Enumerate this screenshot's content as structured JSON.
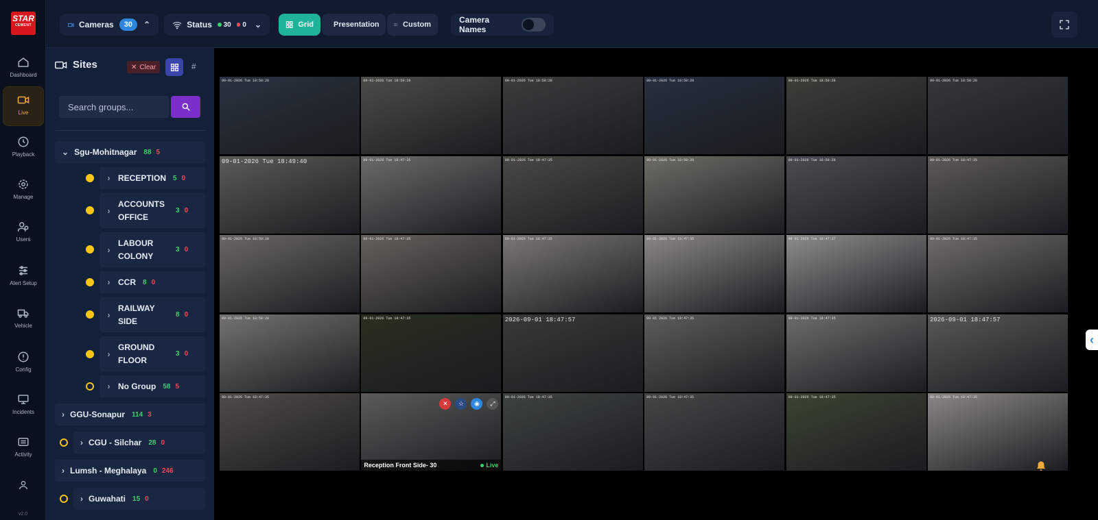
{
  "brand": {
    "logo_text": "STAR",
    "logo_sub": "CEMENT"
  },
  "nav": [
    {
      "label": "Dashboard",
      "icon": "home-icon"
    },
    {
      "label": "Live",
      "icon": "video-icon",
      "active": true
    },
    {
      "label": "Playback",
      "icon": "clock-icon"
    },
    {
      "label": "Manage",
      "icon": "gear-icon"
    },
    {
      "label": "Users",
      "icon": "users-icon"
    },
    {
      "label": "Alert Setup",
      "icon": "sliders-icon"
    },
    {
      "label": "Vehicle",
      "icon": "truck-icon"
    },
    {
      "label": "Config",
      "icon": "alert-circle-icon"
    },
    {
      "label": "Incidents",
      "icon": "monitor-icon"
    },
    {
      "label": "Activity",
      "icon": "list-icon"
    },
    {
      "label": "",
      "icon": "user-icon"
    }
  ],
  "version": "v2.0",
  "toolbar": {
    "cameras_label": "Cameras",
    "cameras_count": "30",
    "status_label": "Status",
    "status_online": "30",
    "status_offline": "0",
    "views": [
      "Grid",
      "Presentation",
      "Custom"
    ],
    "active_view": "Grid",
    "camera_names_label": "Camera Names",
    "camera_names_on": false
  },
  "sidebar": {
    "title": "Sites",
    "clear_label": "Clear",
    "hash_label": "#",
    "search_placeholder": "Search groups...",
    "groups": [
      {
        "name": "Sgu-Mohitnagar",
        "online": "88",
        "offline": "5",
        "expanded": true,
        "children": [
          {
            "name": "RECEPTION",
            "online": "5",
            "offline": "0",
            "status": "filled"
          },
          {
            "name": "ACCOUNTS OFFICE",
            "online": "3",
            "offline": "0",
            "status": "filled"
          },
          {
            "name": "LABOUR COLONY",
            "online": "3",
            "offline": "0",
            "status": "filled"
          },
          {
            "name": "CCR",
            "online": "8",
            "offline": "0",
            "status": "filled"
          },
          {
            "name": "RAILWAY SIDE",
            "online": "8",
            "offline": "0",
            "status": "filled"
          },
          {
            "name": "GROUND FLOOR",
            "online": "3",
            "offline": "0",
            "status": "filled"
          },
          {
            "name": "No Group",
            "online": "58",
            "offline": "5",
            "status": "hollow"
          }
        ]
      },
      {
        "name": "GGU-Sonapur",
        "online": "114",
        "offline": "3"
      },
      {
        "name": "CGU - Silchar",
        "online": "28",
        "offline": "0",
        "status": "hollow"
      },
      {
        "name": "Lumsh - Meghalaya",
        "online": "0",
        "offline": "246"
      },
      {
        "name": "Guwahati",
        "online": "15",
        "offline": "0",
        "status": "hollow"
      }
    ]
  },
  "cameras": [
    {
      "ts": "09-01-2026 Tue 18:50:28",
      "bg": "#2b3340"
    },
    {
      "ts": "09-01-2026 Tue 18:50:28",
      "bg": "#4a4e47"
    },
    {
      "ts": "09-01-2026 Tue 18:50:28",
      "bg": "#3b3e3d"
    },
    {
      "ts": "09-01-2026 Tue 18:50:28",
      "bg": "#27303f"
    },
    {
      "ts": "09-01-2026 Tue 18:50:28",
      "bg": "#3c4038"
    },
    {
      "ts": "09-01-2026 Tue 18:50:28",
      "bg": "#35393b"
    },
    {
      "ts": "09-01-2026 Tue 18:49:40",
      "bg": "#5a5c57",
      "big": true
    },
    {
      "ts": "09-01-2026 Tue 18:47:35",
      "bg": "#6b6b6a"
    },
    {
      "ts": "09-01-2026 Tue 18:47:35",
      "bg": "#4a4945"
    },
    {
      "ts": "09-01-2026 Tue 18:50:28",
      "bg": "#6e6d66"
    },
    {
      "ts": "09-01-2026 Tue 18:50:28",
      "bg": "#4a4e50"
    },
    {
      "ts": "09-01-2026 Tue 18:47:35",
      "bg": "#5c5a57"
    },
    {
      "ts": "09-01-2026 Tue 18:50:28",
      "bg": "#6a6865"
    },
    {
      "ts": "09-01-2026 Tue 18:47:35",
      "bg": "#66625c"
    },
    {
      "ts": "09-01-2026 Tue 18:47:35",
      "bg": "#7a7874"
    },
    {
      "ts": "09-01-2026 Tue 18:47:35",
      "bg": "#8a8886"
    },
    {
      "ts": "09 01 2026 Tue 18:47:37",
      "bg": "#8b8e8c"
    },
    {
      "ts": "09-01-2026 Tue 18:47:35",
      "bg": "#6f6d69"
    },
    {
      "ts": "09-01-2026 Tue 18:50:28",
      "bg": "#74736f"
    },
    {
      "ts": "09-01-2026 Tue 18:47:35",
      "bg": "#2a3020"
    },
    {
      "ts": "2026-09-01 18:47:57",
      "bg": "#3a3a38",
      "big": true
    },
    {
      "ts": "09 01 2026 Tue 18:47:35",
      "bg": "#5e5d5a"
    },
    {
      "ts": "09-01-2026 Tue 18:47:35",
      "bg": "#6a6e6b"
    },
    {
      "ts": "2026-09-01 18:47:57",
      "bg": "#585856",
      "big": true
    },
    {
      "ts": "09-01-2026 Tue 18:47:35",
      "bg": "#4f4c48"
    },
    {
      "ts": "",
      "bg": "#5a5b5a",
      "caption": "Reception Front Side- 30",
      "status": "Live",
      "actions": true
    },
    {
      "ts": "09-01-2026 Tue 18:47:35",
      "bg": "#3e4442"
    },
    {
      "ts": "09-01-2026 Tue 18:47:35",
      "bg": "#454747"
    },
    {
      "ts": "09-01-2026 Tue 18:47:35",
      "bg": "#3c4533"
    },
    {
      "ts": "09-01-2026 Tue 18:47:35",
      "bg": "#8a8885"
    }
  ],
  "colors": {
    "accent": "#1fb39a",
    "online": "#3ecf6e",
    "offline": "#ef4a5a",
    "warn": "#f5c518",
    "live_active": "#f2a93b"
  }
}
